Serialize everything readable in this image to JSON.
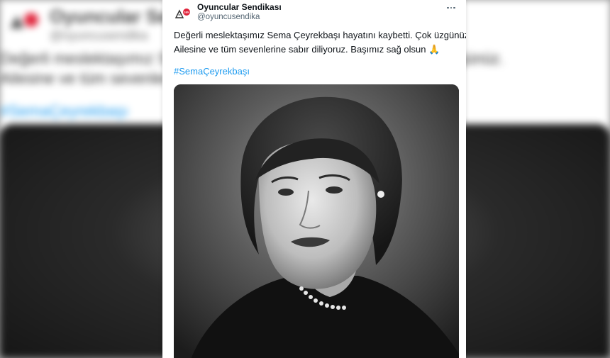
{
  "tweet": {
    "display_name": "Oyuncular Sendikası",
    "handle": "@oyuncusendika",
    "text_line1": "Değerli meslektaşımız Sema Çeyrekbaşı hayatını kaybetti. Çok üzgünüz.",
    "text_line2": "Ailesine ve tüm sevenlerine sabır diliyoruz. Başımız sağ olsun 🙏",
    "hashtag": "#SemaÇeyrekbaşı",
    "photo_icon": "portrait-photo",
    "more_icon": "more-options-icon"
  },
  "colors": {
    "link": "#1d9bf0",
    "text": "#0f1419",
    "muted": "#536471",
    "logo_red": "#e0243b"
  }
}
